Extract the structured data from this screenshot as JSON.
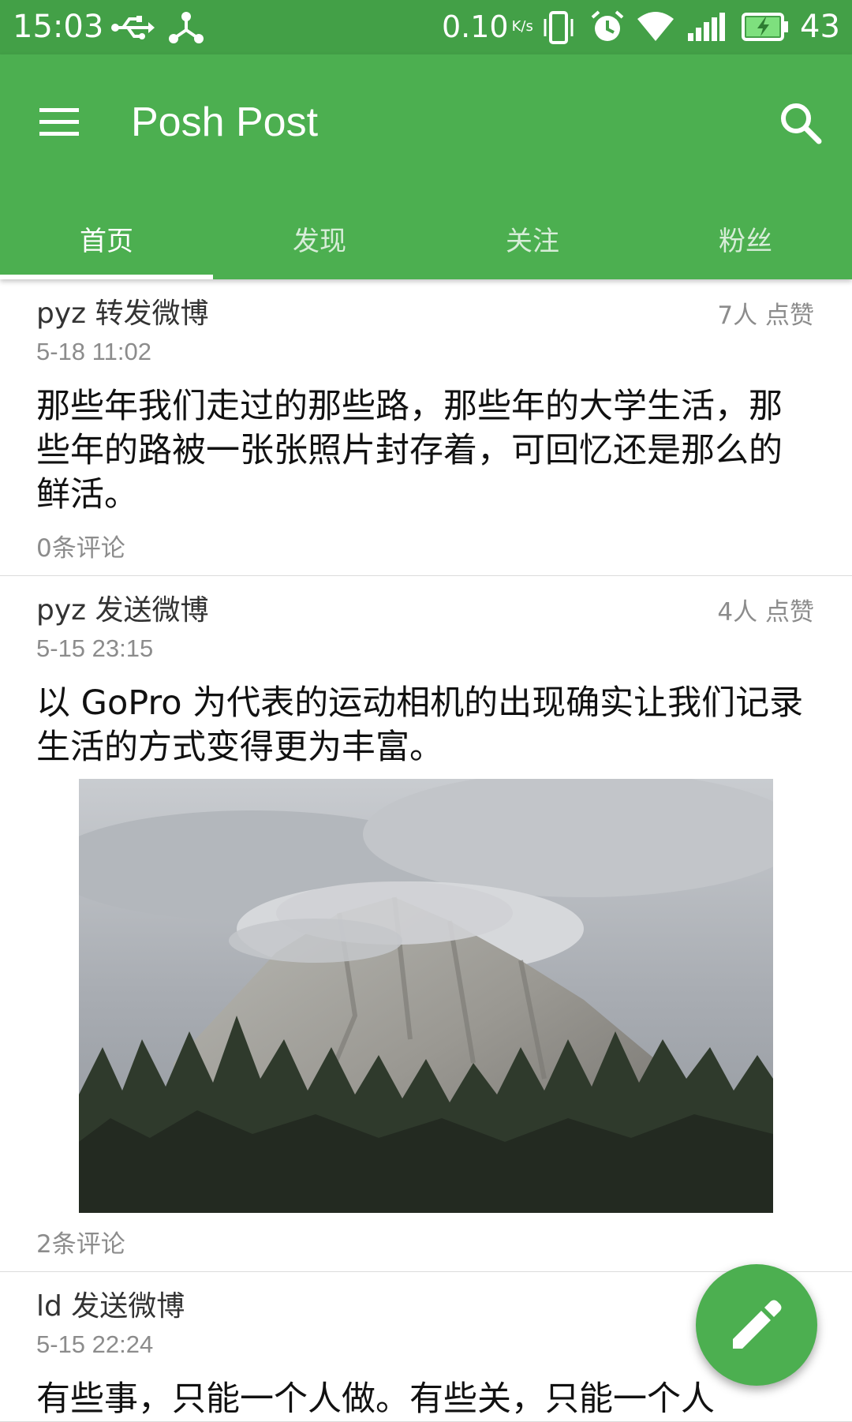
{
  "status_bar": {
    "time": "15:03",
    "net_speed": "0.10",
    "net_unit": "K/s",
    "battery_level": "43",
    "icons": [
      "usb-icon",
      "share-icon",
      "vibrate-icon",
      "alarm-icon",
      "wifi-icon",
      "signal-icon",
      "battery-charging-icon"
    ]
  },
  "app_bar": {
    "title": "Posh Post",
    "menu_icon": "menu-icon",
    "search_icon": "search-icon"
  },
  "tabs": [
    {
      "label": "首页",
      "active": true
    },
    {
      "label": "发现",
      "active": false
    },
    {
      "label": "关注",
      "active": false
    },
    {
      "label": "粉丝",
      "active": false
    }
  ],
  "posts": [
    {
      "author_action": "pyz 转发微博",
      "time": "5-18 11:02",
      "likes": "7人 点赞",
      "content": "那些年我们走过的那些路，那些年的大学生活，那些年的路被一张张照片封存着，可回忆还是那么的鲜活。",
      "comments": "0条评论"
    },
    {
      "author_action": "pyz 发送微博",
      "time": "5-15 23:15",
      "likes": "4人 点赞",
      "content": "以 GoPro 为代表的运动相机的出现确实让我们记录生活的方式变得更为丰富。",
      "image": "mountain-photo",
      "comments": "2条评论"
    },
    {
      "author_action": "ld 发送微博",
      "time": "5-15 22:24",
      "content": "有些事，只能一个人做。有些关，只能一个人"
    }
  ],
  "fab": {
    "icon": "edit-icon"
  },
  "colors": {
    "primary": "#4caf50",
    "status_bar": "#43a047",
    "secondary_text": "#8c8c8c"
  }
}
